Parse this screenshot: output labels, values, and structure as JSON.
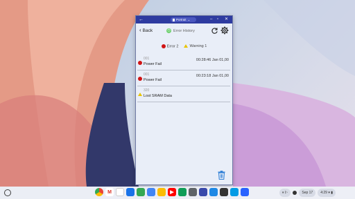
{
  "window": {
    "tab_label": "Portrait",
    "back_label": "Back",
    "title": "Error History",
    "summary": {
      "error_label": "Error 2",
      "warning_label": "Warning 1"
    },
    "items": [
      {
        "code": "001",
        "label": "Power Fail",
        "time": "00:28:46 Jan 01,00",
        "severity": "error"
      },
      {
        "code": "001",
        "label": "Power Fail",
        "time": "00:23:18 Jan 01,00",
        "severity": "error"
      },
      {
        "code": "320",
        "label": "Lost SRAM Data",
        "time": "",
        "severity": "warning"
      }
    ]
  },
  "shelf": {
    "date": "Sep 17",
    "time": "4:29"
  },
  "colors": {
    "titlebar": "#2e3ba0",
    "error": "#d01414",
    "warning": "#e8c400",
    "trash": "#2f7fd6"
  }
}
